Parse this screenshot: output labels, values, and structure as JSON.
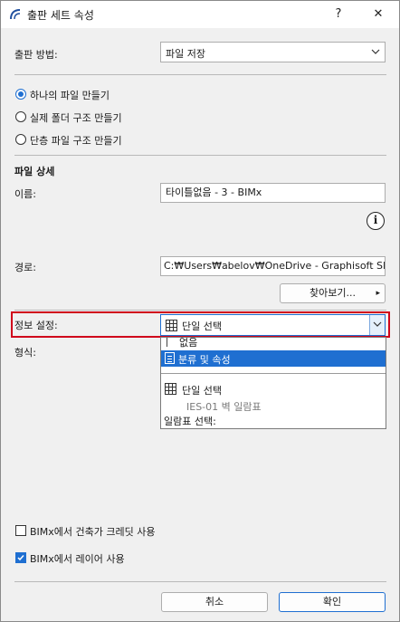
{
  "window": {
    "title": "출판 세트 속성",
    "help_label": "?",
    "close_label": "✕"
  },
  "publish_method": {
    "label": "출판 방법:",
    "value": "파일 저장"
  },
  "structure_options": [
    {
      "label": "하나의 파일 만들기",
      "selected": true
    },
    {
      "label": "실제 폴더 구조 만들기",
      "selected": false
    },
    {
      "label": "단층 파일 구조 만들기",
      "selected": false
    }
  ],
  "file_details": {
    "heading": "파일 상세",
    "name_label": "이름:",
    "name_value": "타이틀없음 - 3 - BIMx",
    "info_icon_glyph": "i",
    "path_label": "경로:",
    "path_value": "C:₩Users₩abelov₩OneDrive - Graphisoft SE₩LC",
    "browse_label": "찾아보기...",
    "browse_arrow": "▸"
  },
  "info_settings": {
    "label": "정보 설정:",
    "selected_value": "단일 선택",
    "highlight_color": "#d0021b"
  },
  "format": {
    "label": "형식:"
  },
  "dropdown": {
    "items": [
      {
        "label": "없음",
        "type": "option"
      },
      {
        "label": "분류 및 속성",
        "type": "option-selected"
      },
      {
        "label": "단일 선택",
        "type": "option"
      },
      {
        "label": "IES-01 벽 일람표",
        "type": "sub-option"
      },
      {
        "label": "일람표 선택:",
        "type": "heading"
      }
    ]
  },
  "bimx_options": [
    {
      "label": "BIMx에서 건축가 크레딧 사용",
      "checked": false
    },
    {
      "label": "BIMx에서 레이어 사용",
      "checked": true
    }
  ],
  "footer": {
    "cancel_label": "취소",
    "ok_label": "확인"
  },
  "colors": {
    "accent": "#1f6fd1",
    "selection_bg": "#1f6fd1",
    "highlight_border": "#d0021b"
  }
}
